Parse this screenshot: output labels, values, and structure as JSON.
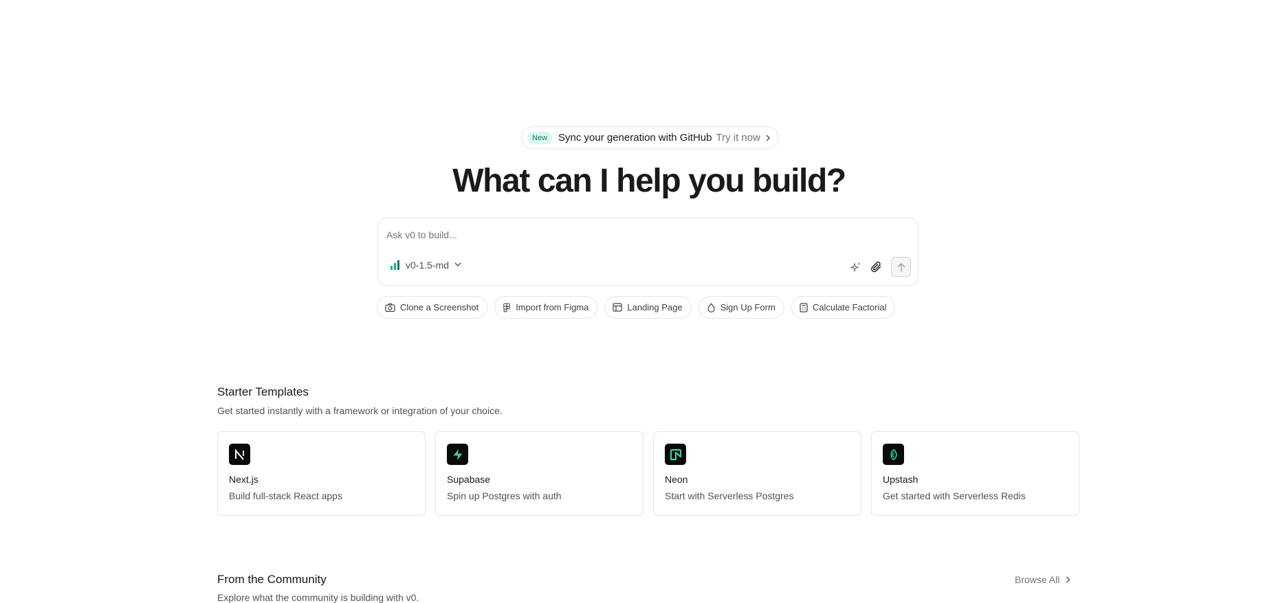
{
  "announcement": {
    "badge": "New",
    "message": "Sync your generation with GitHub",
    "cta": "Try it now"
  },
  "headline": "What can I help you build?",
  "prompt": {
    "placeholder": "Ask v0 to build...",
    "model": "v0-1.5-md",
    "icons": [
      "signal-bars-icon",
      "chevron-down-icon",
      "sparkle-icon",
      "paperclip-icon",
      "arrow-up-icon"
    ]
  },
  "suggestions": [
    {
      "label": "Clone a Screenshot",
      "icon": "camera-icon"
    },
    {
      "label": "Import from Figma",
      "icon": "figma-icon"
    },
    {
      "label": "Landing Page",
      "icon": "layout-icon"
    },
    {
      "label": "Sign Up Form",
      "icon": "droplet-icon"
    },
    {
      "label": "Calculate Factorial",
      "icon": "calculator-icon"
    }
  ],
  "starter_templates": {
    "title": "Starter Templates",
    "subtitle": "Get started instantly with a framework or integration of your choice.",
    "items": [
      {
        "name": "Next.js",
        "desc": "Build full-stack React apps",
        "icon": "nextjs-logo-icon"
      },
      {
        "name": "Supabase",
        "desc": "Spin up Postgres with auth",
        "icon": "supabase-logo-icon"
      },
      {
        "name": "Neon",
        "desc": "Start with Serverless Postgres",
        "icon": "neon-logo-icon"
      },
      {
        "name": "Upstash",
        "desc": "Get started with Serverless Redis",
        "icon": "upstash-logo-icon"
      }
    ]
  },
  "community": {
    "title": "From the Community",
    "subtitle": "Explore what the community is building with v0.",
    "browse_label": "Browse All"
  },
  "colors": {
    "accent_green": "#10b981",
    "badge_bg": "#d9f7ee",
    "badge_text": "#0f766e",
    "border": "#e5e5e5"
  }
}
